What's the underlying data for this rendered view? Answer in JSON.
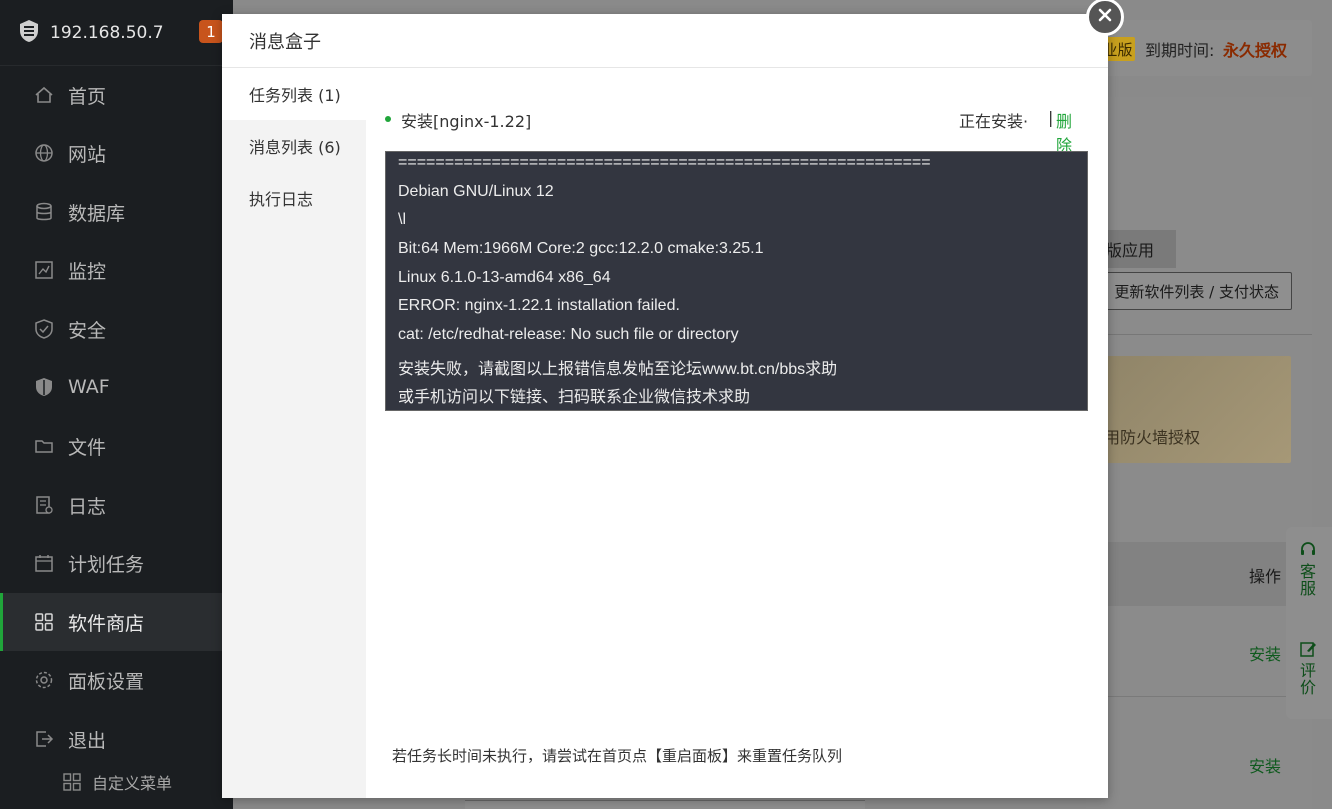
{
  "sidebar": {
    "ip": "192.168.50.7",
    "badge": "1",
    "items": [
      {
        "label": "首页",
        "icon": "home-icon"
      },
      {
        "label": "网站",
        "icon": "globe-icon"
      },
      {
        "label": "数据库",
        "icon": "database-icon"
      },
      {
        "label": "监控",
        "icon": "monitor-icon"
      },
      {
        "label": "安全",
        "icon": "shield-icon"
      },
      {
        "label": "WAF",
        "icon": "waf-shield-icon"
      },
      {
        "label": "文件",
        "icon": "folder-icon"
      },
      {
        "label": "日志",
        "icon": "log-icon"
      },
      {
        "label": "计划任务",
        "icon": "calendar-icon"
      },
      {
        "label": "软件商店",
        "icon": "apps-grid-icon",
        "active": true
      },
      {
        "label": "面板设置",
        "icon": "gear-icon"
      },
      {
        "label": "退出",
        "icon": "logout-icon"
      }
    ],
    "custom_menu": "自定义菜单"
  },
  "background": {
    "edition_badge": "业版",
    "expire_label": "到期时间:",
    "expire_value": "永久授权",
    "tab_label": "版应用",
    "update_button": "更新软件列表 / 支付状态",
    "banner_text": "用防火墙授权",
    "op_label": "操作",
    "install_1": "安装",
    "install_2": "安装",
    "float_service": "客服",
    "float_review": "评价"
  },
  "modal": {
    "title": "消息盒子",
    "tabs": [
      {
        "label": "任务列表 (1)",
        "active": true
      },
      {
        "label": "消息列表 (6)"
      },
      {
        "label": "执行日志"
      }
    ],
    "task": {
      "name": "安装[nginx-1.22]",
      "status": "正在安装·",
      "separator": "|",
      "delete": "删除"
    },
    "console_lines": [
      "=========================================================",
      "Debian GNU/Linux 12",
      "\\l",
      "Bit:64 Mem:1966M Core:2 gcc:12.2.0 cmake:3.25.1",
      "Linux 6.1.0-13-amd64 x86_64",
      "ERROR: nginx-1.22.1 installation failed.",
      "cat: /etc/redhat-release: No such file or directory",
      "安装失败，请截图以上报错信息发帖至论坛www.bt.cn/bbs求助",
      "或手机访问以下链接、扫码联系企业微信技术求助"
    ],
    "footer_note": "若任务长时间未执行，请尝试在首页点【重启面板】来重置任务队列"
  }
}
